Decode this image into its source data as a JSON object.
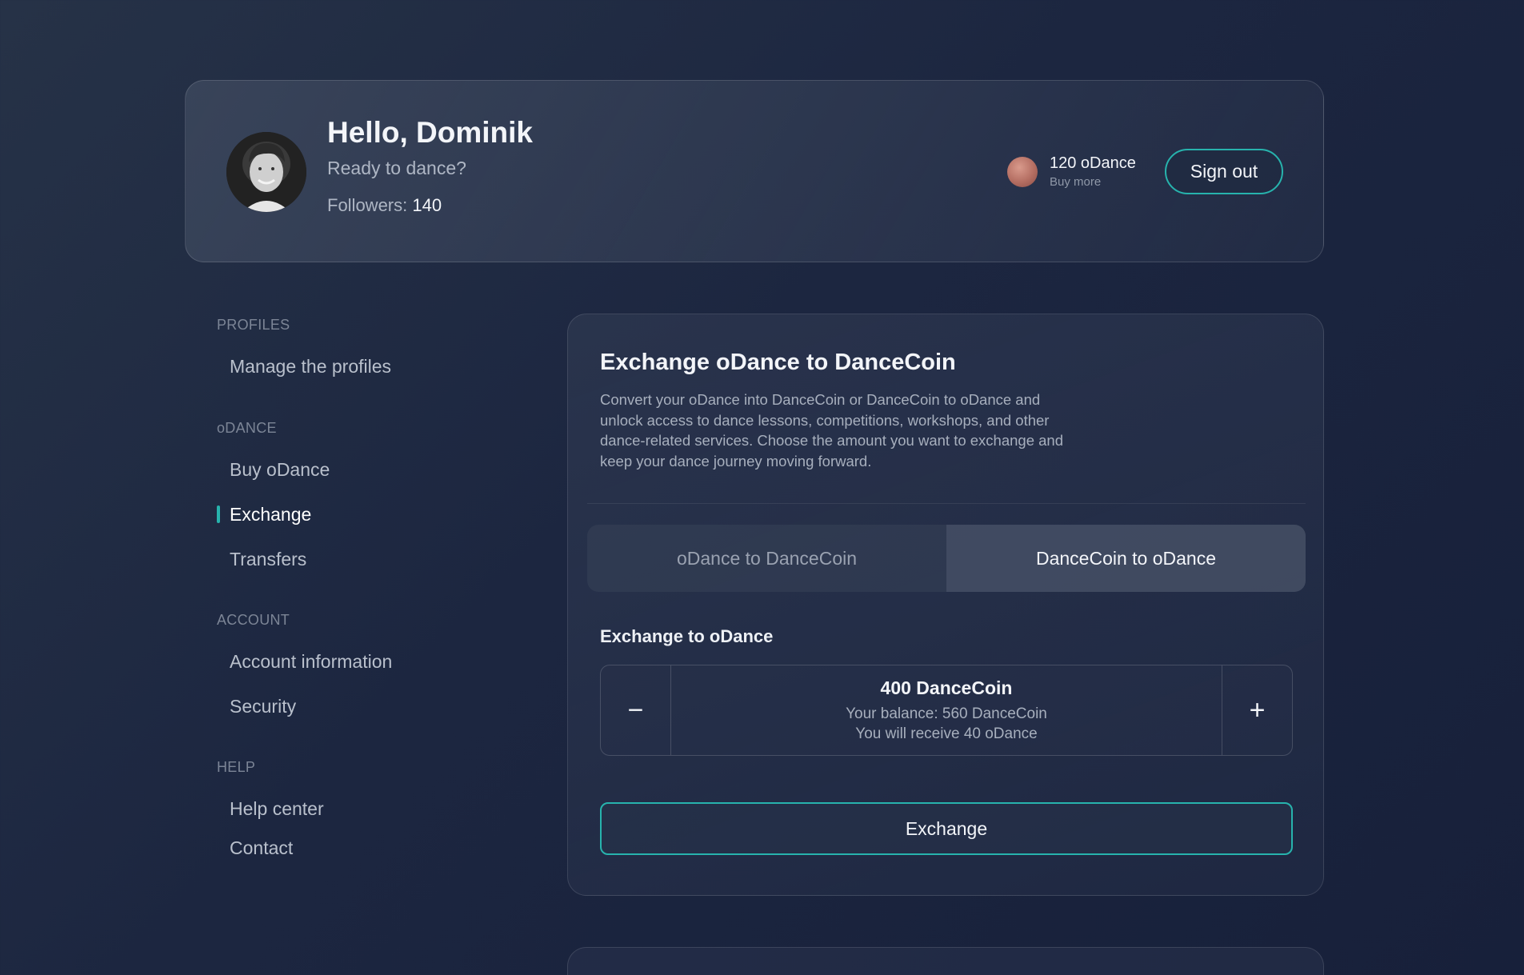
{
  "header": {
    "greeting": "Hello, Dominik",
    "subtitle": "Ready to dance?",
    "followers_label": "Followers: ",
    "followers_count": "140",
    "balance": "120 oDance",
    "buy_more": "Buy more",
    "sign_out": "Sign out"
  },
  "sidebar": {
    "sections": [
      {
        "title": "PROFILES",
        "items": [
          {
            "label": "Manage the profiles"
          }
        ]
      },
      {
        "title": "oDANCE",
        "items": [
          {
            "label": "Buy oDance"
          },
          {
            "label": "Exchange",
            "active": true
          },
          {
            "label": "Transfers"
          }
        ]
      },
      {
        "title": "ACCOUNT",
        "items": [
          {
            "label": "Account information"
          },
          {
            "label": "Security"
          }
        ]
      },
      {
        "title": "HELP",
        "items": [
          {
            "label": "Help center"
          },
          {
            "label": "Contact"
          }
        ]
      }
    ]
  },
  "main": {
    "title": "Exchange oDance to DanceCoin",
    "description": "Convert your oDance into DanceCoin or DanceCoin to oDance and unlock access to dance lessons, competitions, workshops, and other dance-related services. Choose the amount you want to exchange and keep your dance journey moving forward.",
    "tabs": [
      {
        "label": "oDance to DanceCoin",
        "active": false
      },
      {
        "label": "DanceCoin to oDance",
        "active": true
      }
    ],
    "exchange_label": "Exchange to oDance",
    "stepper": {
      "minus": "−",
      "plus": "+",
      "amount": "400 DanceCoin",
      "balance_text": "Your balance: 560 DanceCoin",
      "receive_text": "You will receive 40 oDance"
    },
    "exchange_button": "Exchange"
  },
  "colors": {
    "accent": "#27b3ad",
    "background": "#1c2640"
  }
}
